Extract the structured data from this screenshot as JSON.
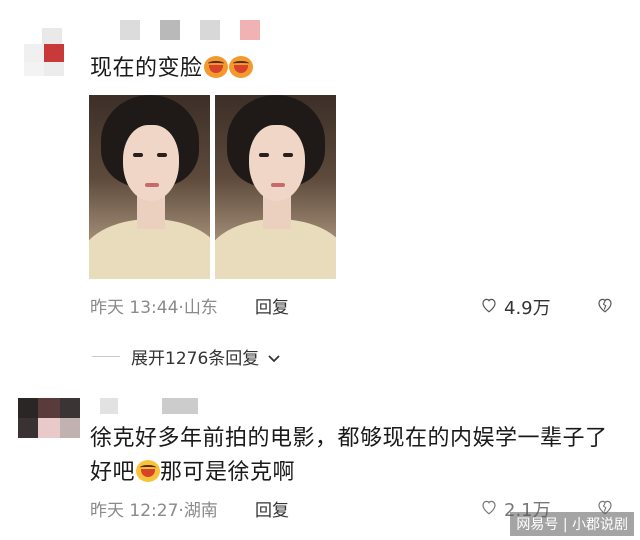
{
  "comments": [
    {
      "text": "现在的变脸",
      "emojis": [
        "laughing-crying-emoji",
        "laughing-crying-emoji"
      ],
      "time": "昨天 13:44",
      "location": "山东",
      "reply_label": "回复",
      "likes": "4.9万"
    },
    {
      "text_line1": "徐克好多年前拍的电影，都够现在的内娱学一辈子了",
      "text_line2a": "好吧",
      "text_line2b": "那可是徐克啊",
      "time": "昨天 12:27",
      "location": "湖南",
      "reply_label": "回复",
      "likes": "2.1万"
    }
  ],
  "expand_replies": "展开1276条回复",
  "watermark": "网易号 | 小郡说剧",
  "colors": {
    "meta": "#8a8a8a",
    "text": "#1a1a1a",
    "divider": "#c8c8c8"
  }
}
